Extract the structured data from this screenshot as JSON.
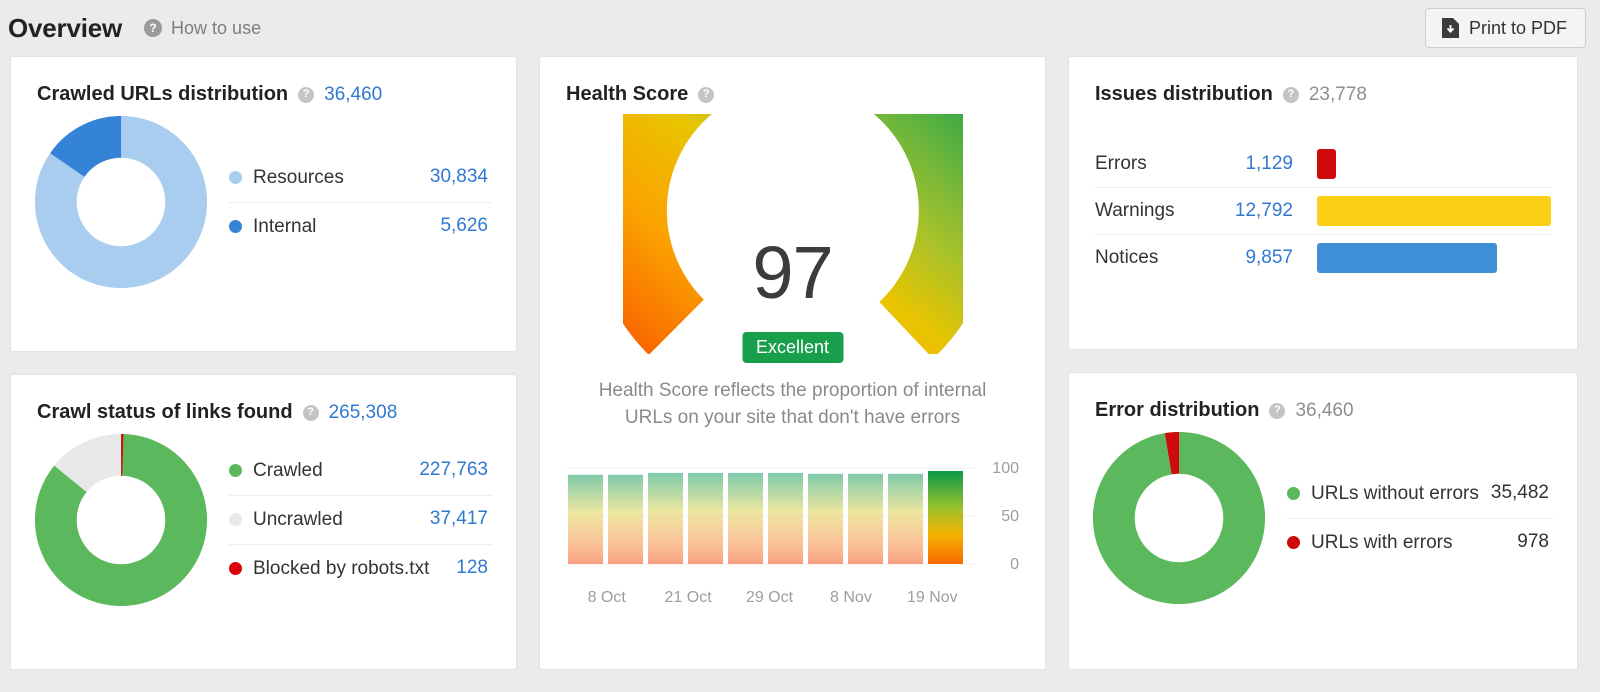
{
  "header": {
    "title": "Overview",
    "help_icon": "help-circle-icon",
    "how_to_use": "How to use",
    "print_label": "Print to PDF",
    "print_icon": "pdf-download-icon"
  },
  "colors": {
    "link_blue": "#2f79d0",
    "resources_light_blue": "#a8cdee",
    "internal_blue": "#3583d6",
    "crawled_green": "#5cb85c",
    "uncrawled_gray": "#e8e8e8",
    "blocked_red": "#d9040a",
    "error_red": "#cf0a0a",
    "warning_yellow": "#fbd014",
    "notice_blue": "#3f8fd6",
    "badge_green": "#199f4b"
  },
  "cards": {
    "crawled_urls": {
      "title": "Crawled URLs distribution",
      "total": "36,460",
      "chart_data": {
        "type": "pie",
        "title": "Crawled URLs distribution",
        "categories": [
          "Resources",
          "Internal"
        ],
        "values": [
          30834,
          5626
        ],
        "colors": [
          "#a8cdee",
          "#3583d6"
        ],
        "legend": [
          {
            "label": "Resources",
            "value": "30,834",
            "color": "#a8cdee"
          },
          {
            "label": "Internal",
            "value": "5,626",
            "color": "#3583d6"
          }
        ]
      }
    },
    "crawl_status": {
      "title": "Crawl status of links found",
      "total": "265,308",
      "chart_data": {
        "type": "pie",
        "title": "Crawl status of links found",
        "categories": [
          "Crawled",
          "Uncrawled",
          "Blocked by robots.txt"
        ],
        "values": [
          227763,
          37417,
          128
        ],
        "colors": [
          "#5cb85c",
          "#e8e8e8",
          "#d9040a"
        ],
        "legend": [
          {
            "label": "Crawled",
            "value": "227,763",
            "color": "#5cb85c"
          },
          {
            "label": "Uncrawled",
            "value": "37,417",
            "color": "#e8e8e8"
          },
          {
            "label": "Blocked by robots.txt",
            "value": "128",
            "color": "#d9040a"
          }
        ]
      }
    },
    "health_score": {
      "title": "Health Score",
      "score": "97",
      "badge": "Excellent",
      "description": "Health Score reflects the proportion of internal URLs on your site that don't have errors",
      "chart_data": {
        "type": "bar",
        "title": "Health Score history",
        "ylabel": "",
        "xlabel": "",
        "ylim": [
          0,
          100
        ],
        "yticks": [
          "100",
          "50",
          "0"
        ],
        "categories": [
          "8 Oct",
          "21 Oct",
          "29 Oct",
          "8 Nov",
          "19 Nov"
        ],
        "tick_labels": [
          "8 Oct",
          "21 Oct",
          "29 Oct",
          "8 Nov",
          "19 Nov"
        ],
        "values": [
          94,
          94,
          96,
          96,
          96,
          96,
          95,
          95,
          95,
          97
        ],
        "gauge": {
          "value": 97,
          "min": 0,
          "max": 100,
          "label": "Excellent"
        }
      }
    },
    "issues_distribution": {
      "title": "Issues distribution",
      "total": "23,778",
      "chart_data": {
        "type": "bar",
        "title": "Issues distribution",
        "categories": [
          "Errors",
          "Warnings",
          "Notices"
        ],
        "values": [
          1129,
          12792,
          9857
        ],
        "value_labels": [
          "1,129",
          "12,792",
          "9,857"
        ],
        "colors": [
          "#cf0a0a",
          "#fbd014",
          "#3f8fd6"
        ],
        "xlim": [
          0,
          13700
        ]
      }
    },
    "error_distribution": {
      "title": "Error distribution",
      "total": "36,460",
      "chart_data": {
        "type": "pie",
        "title": "Error distribution",
        "categories": [
          "URLs without errors",
          "URLs with errors"
        ],
        "values": [
          35482,
          978
        ],
        "colors": [
          "#5cb85c",
          "#cf0a0a"
        ],
        "legend": [
          {
            "label": "URLs without errors",
            "value": "35,482",
            "color": "#5cb85c"
          },
          {
            "label": "URLs with errors",
            "value": "978",
            "color": "#cf0a0a"
          }
        ]
      }
    }
  }
}
